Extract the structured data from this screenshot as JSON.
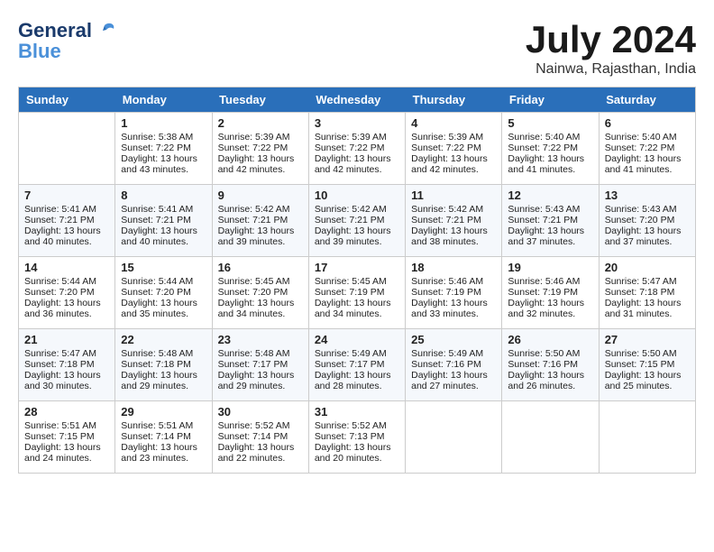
{
  "logo": {
    "line1": "General",
    "line2": "Blue"
  },
  "title": {
    "month_year": "July 2024",
    "location": "Nainwa, Rajasthan, India"
  },
  "days_of_week": [
    "Sunday",
    "Monday",
    "Tuesday",
    "Wednesday",
    "Thursday",
    "Friday",
    "Saturday"
  ],
  "weeks": [
    [
      {
        "day": "",
        "info": ""
      },
      {
        "day": "1",
        "info": "Sunrise: 5:38 AM\nSunset: 7:22 PM\nDaylight: 13 hours\nand 43 minutes."
      },
      {
        "day": "2",
        "info": "Sunrise: 5:39 AM\nSunset: 7:22 PM\nDaylight: 13 hours\nand 42 minutes."
      },
      {
        "day": "3",
        "info": "Sunrise: 5:39 AM\nSunset: 7:22 PM\nDaylight: 13 hours\nand 42 minutes."
      },
      {
        "day": "4",
        "info": "Sunrise: 5:39 AM\nSunset: 7:22 PM\nDaylight: 13 hours\nand 42 minutes."
      },
      {
        "day": "5",
        "info": "Sunrise: 5:40 AM\nSunset: 7:22 PM\nDaylight: 13 hours\nand 41 minutes."
      },
      {
        "day": "6",
        "info": "Sunrise: 5:40 AM\nSunset: 7:22 PM\nDaylight: 13 hours\nand 41 minutes."
      }
    ],
    [
      {
        "day": "7",
        "info": "Sunrise: 5:41 AM\nSunset: 7:21 PM\nDaylight: 13 hours\nand 40 minutes."
      },
      {
        "day": "8",
        "info": "Sunrise: 5:41 AM\nSunset: 7:21 PM\nDaylight: 13 hours\nand 40 minutes."
      },
      {
        "day": "9",
        "info": "Sunrise: 5:42 AM\nSunset: 7:21 PM\nDaylight: 13 hours\nand 39 minutes."
      },
      {
        "day": "10",
        "info": "Sunrise: 5:42 AM\nSunset: 7:21 PM\nDaylight: 13 hours\nand 39 minutes."
      },
      {
        "day": "11",
        "info": "Sunrise: 5:42 AM\nSunset: 7:21 PM\nDaylight: 13 hours\nand 38 minutes."
      },
      {
        "day": "12",
        "info": "Sunrise: 5:43 AM\nSunset: 7:21 PM\nDaylight: 13 hours\nand 37 minutes."
      },
      {
        "day": "13",
        "info": "Sunrise: 5:43 AM\nSunset: 7:20 PM\nDaylight: 13 hours\nand 37 minutes."
      }
    ],
    [
      {
        "day": "14",
        "info": "Sunrise: 5:44 AM\nSunset: 7:20 PM\nDaylight: 13 hours\nand 36 minutes."
      },
      {
        "day": "15",
        "info": "Sunrise: 5:44 AM\nSunset: 7:20 PM\nDaylight: 13 hours\nand 35 minutes."
      },
      {
        "day": "16",
        "info": "Sunrise: 5:45 AM\nSunset: 7:20 PM\nDaylight: 13 hours\nand 34 minutes."
      },
      {
        "day": "17",
        "info": "Sunrise: 5:45 AM\nSunset: 7:19 PM\nDaylight: 13 hours\nand 34 minutes."
      },
      {
        "day": "18",
        "info": "Sunrise: 5:46 AM\nSunset: 7:19 PM\nDaylight: 13 hours\nand 33 minutes."
      },
      {
        "day": "19",
        "info": "Sunrise: 5:46 AM\nSunset: 7:19 PM\nDaylight: 13 hours\nand 32 minutes."
      },
      {
        "day": "20",
        "info": "Sunrise: 5:47 AM\nSunset: 7:18 PM\nDaylight: 13 hours\nand 31 minutes."
      }
    ],
    [
      {
        "day": "21",
        "info": "Sunrise: 5:47 AM\nSunset: 7:18 PM\nDaylight: 13 hours\nand 30 minutes."
      },
      {
        "day": "22",
        "info": "Sunrise: 5:48 AM\nSunset: 7:18 PM\nDaylight: 13 hours\nand 29 minutes."
      },
      {
        "day": "23",
        "info": "Sunrise: 5:48 AM\nSunset: 7:17 PM\nDaylight: 13 hours\nand 29 minutes."
      },
      {
        "day": "24",
        "info": "Sunrise: 5:49 AM\nSunset: 7:17 PM\nDaylight: 13 hours\nand 28 minutes."
      },
      {
        "day": "25",
        "info": "Sunrise: 5:49 AM\nSunset: 7:16 PM\nDaylight: 13 hours\nand 27 minutes."
      },
      {
        "day": "26",
        "info": "Sunrise: 5:50 AM\nSunset: 7:16 PM\nDaylight: 13 hours\nand 26 minutes."
      },
      {
        "day": "27",
        "info": "Sunrise: 5:50 AM\nSunset: 7:15 PM\nDaylight: 13 hours\nand 25 minutes."
      }
    ],
    [
      {
        "day": "28",
        "info": "Sunrise: 5:51 AM\nSunset: 7:15 PM\nDaylight: 13 hours\nand 24 minutes."
      },
      {
        "day": "29",
        "info": "Sunrise: 5:51 AM\nSunset: 7:14 PM\nDaylight: 13 hours\nand 23 minutes."
      },
      {
        "day": "30",
        "info": "Sunrise: 5:52 AM\nSunset: 7:14 PM\nDaylight: 13 hours\nand 22 minutes."
      },
      {
        "day": "31",
        "info": "Sunrise: 5:52 AM\nSunset: 7:13 PM\nDaylight: 13 hours\nand 20 minutes."
      },
      {
        "day": "",
        "info": ""
      },
      {
        "day": "",
        "info": ""
      },
      {
        "day": "",
        "info": ""
      }
    ]
  ]
}
